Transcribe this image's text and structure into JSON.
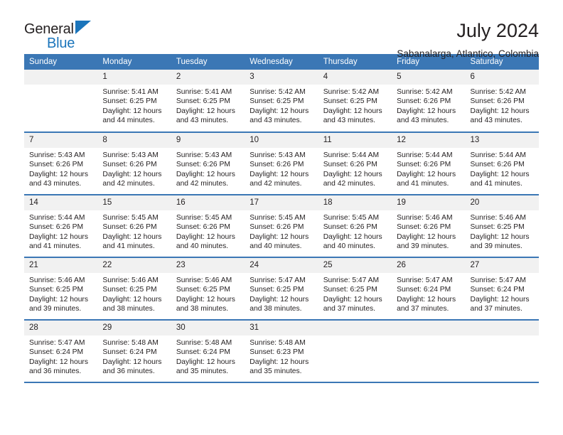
{
  "brand": {
    "name_top": "General",
    "name_bottom": "Blue",
    "triangle_color": "#1b75bb"
  },
  "header": {
    "title": "July 2024",
    "location": "Sabanalarga, Atlantico, Colombia"
  },
  "theme": {
    "header_row_bg": "#3b77b5",
    "daynum_bg": "#f1f1f1",
    "text_color": "#231f20",
    "rule_color": "#3b77b5"
  },
  "calendar": {
    "weekday_headers": [
      "Sunday",
      "Monday",
      "Tuesday",
      "Wednesday",
      "Thursday",
      "Friday",
      "Saturday"
    ],
    "weeks": [
      [
        {
          "day": "",
          "sunrise": "",
          "sunset": "",
          "daylight_line1": "",
          "daylight_line2": ""
        },
        {
          "day": "1",
          "sunrise": "Sunrise: 5:41 AM",
          "sunset": "Sunset: 6:25 PM",
          "daylight_line1": "Daylight: 12 hours",
          "daylight_line2": "and 44 minutes."
        },
        {
          "day": "2",
          "sunrise": "Sunrise: 5:41 AM",
          "sunset": "Sunset: 6:25 PM",
          "daylight_line1": "Daylight: 12 hours",
          "daylight_line2": "and 43 minutes."
        },
        {
          "day": "3",
          "sunrise": "Sunrise: 5:42 AM",
          "sunset": "Sunset: 6:25 PM",
          "daylight_line1": "Daylight: 12 hours",
          "daylight_line2": "and 43 minutes."
        },
        {
          "day": "4",
          "sunrise": "Sunrise: 5:42 AM",
          "sunset": "Sunset: 6:25 PM",
          "daylight_line1": "Daylight: 12 hours",
          "daylight_line2": "and 43 minutes."
        },
        {
          "day": "5",
          "sunrise": "Sunrise: 5:42 AM",
          "sunset": "Sunset: 6:26 PM",
          "daylight_line1": "Daylight: 12 hours",
          "daylight_line2": "and 43 minutes."
        },
        {
          "day": "6",
          "sunrise": "Sunrise: 5:42 AM",
          "sunset": "Sunset: 6:26 PM",
          "daylight_line1": "Daylight: 12 hours",
          "daylight_line2": "and 43 minutes."
        }
      ],
      [
        {
          "day": "7",
          "sunrise": "Sunrise: 5:43 AM",
          "sunset": "Sunset: 6:26 PM",
          "daylight_line1": "Daylight: 12 hours",
          "daylight_line2": "and 43 minutes."
        },
        {
          "day": "8",
          "sunrise": "Sunrise: 5:43 AM",
          "sunset": "Sunset: 6:26 PM",
          "daylight_line1": "Daylight: 12 hours",
          "daylight_line2": "and 42 minutes."
        },
        {
          "day": "9",
          "sunrise": "Sunrise: 5:43 AM",
          "sunset": "Sunset: 6:26 PM",
          "daylight_line1": "Daylight: 12 hours",
          "daylight_line2": "and 42 minutes."
        },
        {
          "day": "10",
          "sunrise": "Sunrise: 5:43 AM",
          "sunset": "Sunset: 6:26 PM",
          "daylight_line1": "Daylight: 12 hours",
          "daylight_line2": "and 42 minutes."
        },
        {
          "day": "11",
          "sunrise": "Sunrise: 5:44 AM",
          "sunset": "Sunset: 6:26 PM",
          "daylight_line1": "Daylight: 12 hours",
          "daylight_line2": "and 42 minutes."
        },
        {
          "day": "12",
          "sunrise": "Sunrise: 5:44 AM",
          "sunset": "Sunset: 6:26 PM",
          "daylight_line1": "Daylight: 12 hours",
          "daylight_line2": "and 41 minutes."
        },
        {
          "day": "13",
          "sunrise": "Sunrise: 5:44 AM",
          "sunset": "Sunset: 6:26 PM",
          "daylight_line1": "Daylight: 12 hours",
          "daylight_line2": "and 41 minutes."
        }
      ],
      [
        {
          "day": "14",
          "sunrise": "Sunrise: 5:44 AM",
          "sunset": "Sunset: 6:26 PM",
          "daylight_line1": "Daylight: 12 hours",
          "daylight_line2": "and 41 minutes."
        },
        {
          "day": "15",
          "sunrise": "Sunrise: 5:45 AM",
          "sunset": "Sunset: 6:26 PM",
          "daylight_line1": "Daylight: 12 hours",
          "daylight_line2": "and 41 minutes."
        },
        {
          "day": "16",
          "sunrise": "Sunrise: 5:45 AM",
          "sunset": "Sunset: 6:26 PM",
          "daylight_line1": "Daylight: 12 hours",
          "daylight_line2": "and 40 minutes."
        },
        {
          "day": "17",
          "sunrise": "Sunrise: 5:45 AM",
          "sunset": "Sunset: 6:26 PM",
          "daylight_line1": "Daylight: 12 hours",
          "daylight_line2": "and 40 minutes."
        },
        {
          "day": "18",
          "sunrise": "Sunrise: 5:45 AM",
          "sunset": "Sunset: 6:26 PM",
          "daylight_line1": "Daylight: 12 hours",
          "daylight_line2": "and 40 minutes."
        },
        {
          "day": "19",
          "sunrise": "Sunrise: 5:46 AM",
          "sunset": "Sunset: 6:26 PM",
          "daylight_line1": "Daylight: 12 hours",
          "daylight_line2": "and 39 minutes."
        },
        {
          "day": "20",
          "sunrise": "Sunrise: 5:46 AM",
          "sunset": "Sunset: 6:25 PM",
          "daylight_line1": "Daylight: 12 hours",
          "daylight_line2": "and 39 minutes."
        }
      ],
      [
        {
          "day": "21",
          "sunrise": "Sunrise: 5:46 AM",
          "sunset": "Sunset: 6:25 PM",
          "daylight_line1": "Daylight: 12 hours",
          "daylight_line2": "and 39 minutes."
        },
        {
          "day": "22",
          "sunrise": "Sunrise: 5:46 AM",
          "sunset": "Sunset: 6:25 PM",
          "daylight_line1": "Daylight: 12 hours",
          "daylight_line2": "and 38 minutes."
        },
        {
          "day": "23",
          "sunrise": "Sunrise: 5:46 AM",
          "sunset": "Sunset: 6:25 PM",
          "daylight_line1": "Daylight: 12 hours",
          "daylight_line2": "and 38 minutes."
        },
        {
          "day": "24",
          "sunrise": "Sunrise: 5:47 AM",
          "sunset": "Sunset: 6:25 PM",
          "daylight_line1": "Daylight: 12 hours",
          "daylight_line2": "and 38 minutes."
        },
        {
          "day": "25",
          "sunrise": "Sunrise: 5:47 AM",
          "sunset": "Sunset: 6:25 PM",
          "daylight_line1": "Daylight: 12 hours",
          "daylight_line2": "and 37 minutes."
        },
        {
          "day": "26",
          "sunrise": "Sunrise: 5:47 AM",
          "sunset": "Sunset: 6:24 PM",
          "daylight_line1": "Daylight: 12 hours",
          "daylight_line2": "and 37 minutes."
        },
        {
          "day": "27",
          "sunrise": "Sunrise: 5:47 AM",
          "sunset": "Sunset: 6:24 PM",
          "daylight_line1": "Daylight: 12 hours",
          "daylight_line2": "and 37 minutes."
        }
      ],
      [
        {
          "day": "28",
          "sunrise": "Sunrise: 5:47 AM",
          "sunset": "Sunset: 6:24 PM",
          "daylight_line1": "Daylight: 12 hours",
          "daylight_line2": "and 36 minutes."
        },
        {
          "day": "29",
          "sunrise": "Sunrise: 5:48 AM",
          "sunset": "Sunset: 6:24 PM",
          "daylight_line1": "Daylight: 12 hours",
          "daylight_line2": "and 36 minutes."
        },
        {
          "day": "30",
          "sunrise": "Sunrise: 5:48 AM",
          "sunset": "Sunset: 6:24 PM",
          "daylight_line1": "Daylight: 12 hours",
          "daylight_line2": "and 35 minutes."
        },
        {
          "day": "31",
          "sunrise": "Sunrise: 5:48 AM",
          "sunset": "Sunset: 6:23 PM",
          "daylight_line1": "Daylight: 12 hours",
          "daylight_line2": "and 35 minutes."
        },
        {
          "day": "",
          "sunrise": "",
          "sunset": "",
          "daylight_line1": "",
          "daylight_line2": ""
        },
        {
          "day": "",
          "sunrise": "",
          "sunset": "",
          "daylight_line1": "",
          "daylight_line2": ""
        },
        {
          "day": "",
          "sunrise": "",
          "sunset": "",
          "daylight_line1": "",
          "daylight_line2": ""
        }
      ]
    ]
  }
}
